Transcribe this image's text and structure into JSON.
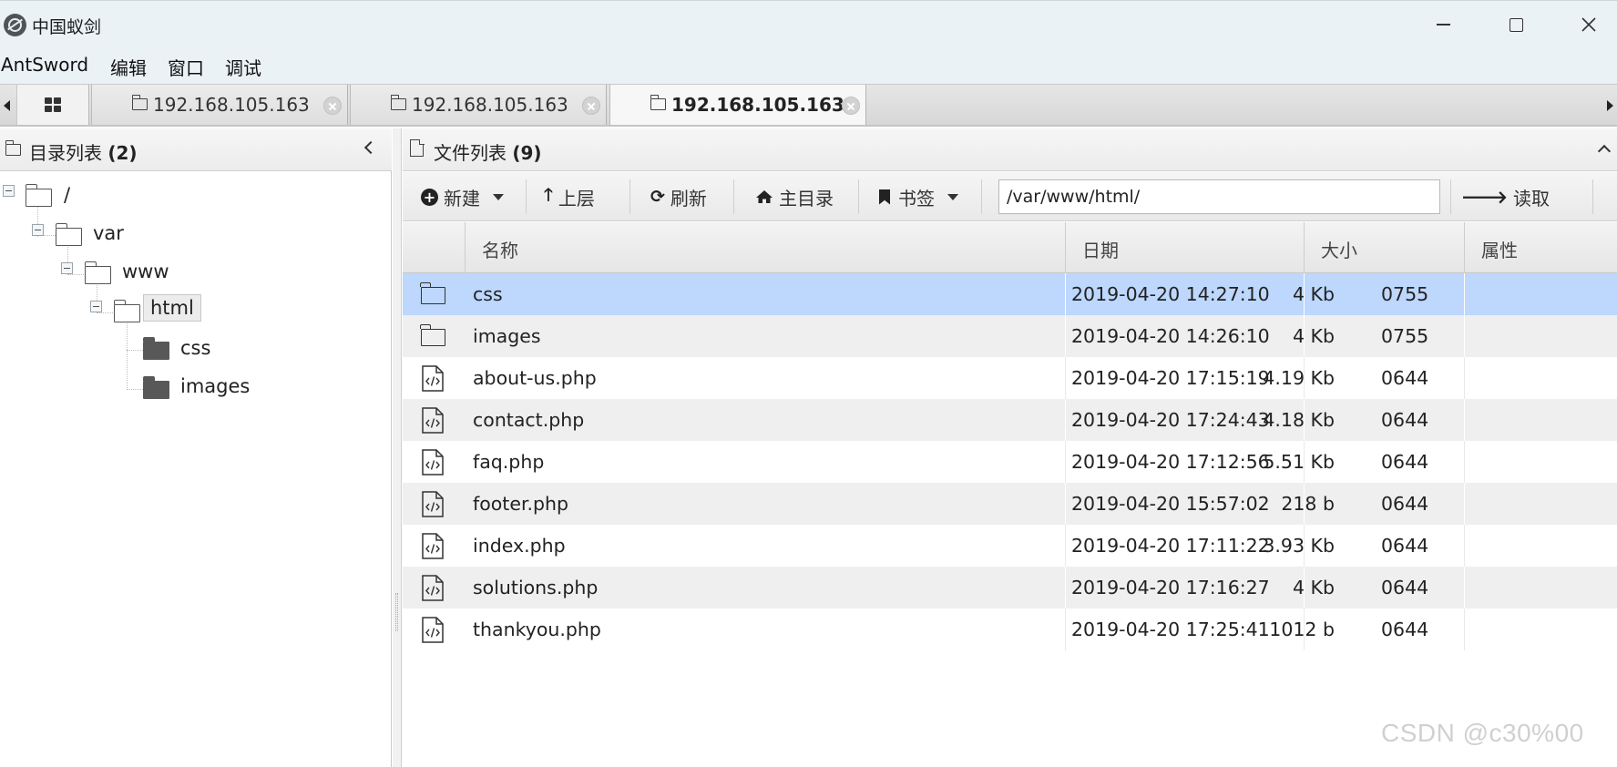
{
  "window": {
    "title": "中国蚁剑",
    "logo": "antsword-logo-icon"
  },
  "menu": {
    "items": [
      "AntSword",
      "编辑",
      "窗口",
      "调试"
    ]
  },
  "tabs": [
    {
      "label": "192.168.105.163",
      "active": false
    },
    {
      "label": "192.168.105.163",
      "active": false
    },
    {
      "label": "192.168.105.163",
      "active": true
    }
  ],
  "left_panel": {
    "title": "目录列表",
    "count": "(2)",
    "tree": {
      "root": "/",
      "var": "var",
      "www": "www",
      "html": "html",
      "css": "css",
      "images": "images"
    }
  },
  "right_panel": {
    "title": "文件列表",
    "count": "(9)",
    "toolbar": {
      "new": "新建",
      "up": "上层",
      "refresh": "刷新",
      "home": "主目录",
      "bookmark": "书签",
      "path": "/var/www/html/",
      "read": "读取"
    },
    "columns": [
      "名称",
      "日期",
      "大小",
      "属性"
    ],
    "files": [
      {
        "type": "folder",
        "name": "css",
        "date": "2019-04-20 14:27:10",
        "size": "4 Kb",
        "attr": "0755",
        "selected": true
      },
      {
        "type": "folder",
        "name": "images",
        "date": "2019-04-20 14:26:10",
        "size": "4 Kb",
        "attr": "0755"
      },
      {
        "type": "code",
        "name": "about-us.php",
        "date": "2019-04-20 17:15:19",
        "size": "4.19 Kb",
        "attr": "0644"
      },
      {
        "type": "code",
        "name": "contact.php",
        "date": "2019-04-20 17:24:43",
        "size": "4.18 Kb",
        "attr": "0644"
      },
      {
        "type": "code",
        "name": "faq.php",
        "date": "2019-04-20 17:12:56",
        "size": "5.51 Kb",
        "attr": "0644"
      },
      {
        "type": "code",
        "name": "footer.php",
        "date": "2019-04-20 15:57:02",
        "size": "218 b",
        "attr": "0644"
      },
      {
        "type": "code",
        "name": "index.php",
        "date": "2019-04-20 17:11:22",
        "size": "3.93 Kb",
        "attr": "0644"
      },
      {
        "type": "code",
        "name": "solutions.php",
        "date": "2019-04-20 17:16:27",
        "size": "4 Kb",
        "attr": "0644"
      },
      {
        "type": "code",
        "name": "thankyou.php",
        "date": "2019-04-20 17:25:41",
        "size": "1012 b",
        "attr": "0644"
      }
    ]
  },
  "watermark": "CSDN @c30%00",
  "colors": {
    "selected_row": "#bdd7fd",
    "titlebar": "#eaf2f5"
  }
}
